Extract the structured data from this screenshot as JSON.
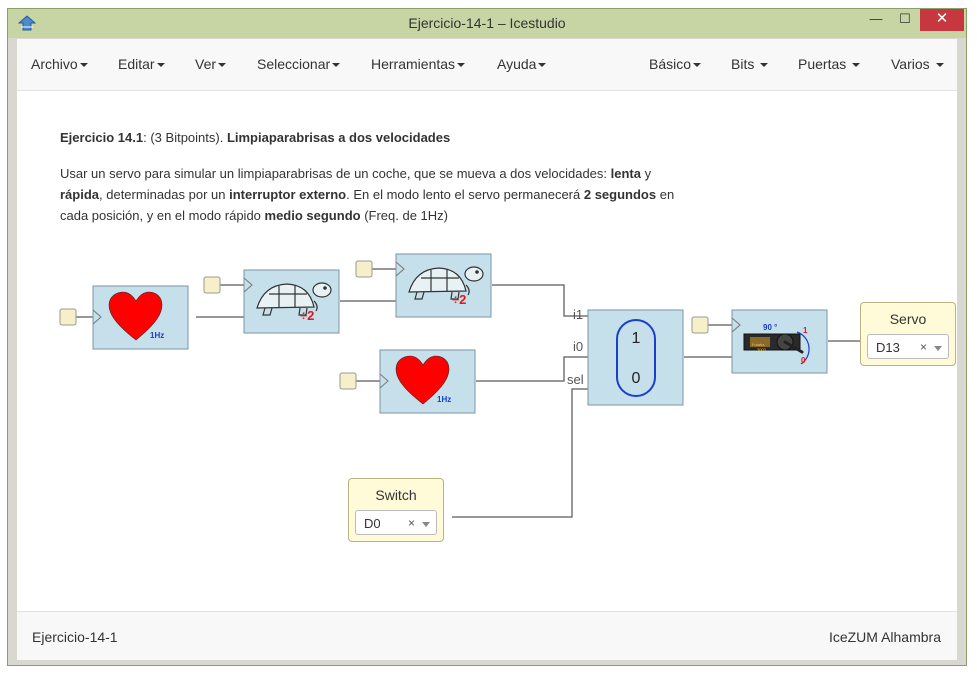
{
  "window": {
    "title": "Ejercicio-14-1 – Icestudio",
    "minimize_glyph": "—",
    "maximize_glyph": "☐",
    "close_glyph": "✕"
  },
  "menu_left": [
    "Archivo",
    "Editar",
    "Ver",
    "Seleccionar",
    "Herramientas",
    "Ayuda"
  ],
  "menu_right": [
    "Básico",
    "Bits",
    "Puertas",
    "Varios"
  ],
  "description": {
    "heading_prefix": "Ejercicio 14.1",
    "heading_mid": ": (3 Bitpoints). ",
    "heading_title": "Limpiaparabrisas a dos velocidades",
    "line1_a": "Usar un servo para simular un limpiaparabrisas de un coche, que se mueva a dos velocidades: ",
    "line1_b": "lenta",
    "line1_c": " y",
    "line2_a": "rápida",
    "line2_b": ", determinadas por un ",
    "line2_c": "interruptor externo",
    "line2_d": ". En el modo lento el servo permanecerá ",
    "line2_e": "2 segundos",
    "line2_f": " en",
    "line3_a": "cada posición, y en el modo rápido ",
    "line3_b": "medio segundo",
    "line3_c": " (Freq. de 1Hz)"
  },
  "blocks": {
    "heart_top_label": "1Hz",
    "heart_bottom_label": "1Hz",
    "turtle1_label": "÷2",
    "turtle2_label": "÷2",
    "mux_top": "1",
    "mux_bottom": "0",
    "mux_port_i1": "i1",
    "mux_port_i0": "i0",
    "mux_port_sel": "sel",
    "servo_angle": "90 °",
    "servo_one": "1",
    "servo_zero": "0",
    "servo_brand": "Futaba",
    "servo_model": "3003"
  },
  "switch_input": {
    "title": "Switch",
    "pin": "D0",
    "clear": "×"
  },
  "servo_output": {
    "title": "Servo",
    "pin": "D13",
    "clear": "×"
  },
  "footer": {
    "left": "Ejercicio-14-1",
    "right": "IceZUM Alhambra"
  },
  "colors": {
    "block_fill": "#c5e0ea",
    "block_stroke": "#7a96a4",
    "heart": "#ff0000",
    "mux_capsule": "#1a3fcc",
    "wire": "#777777",
    "io_fill": "#fffbd8"
  }
}
